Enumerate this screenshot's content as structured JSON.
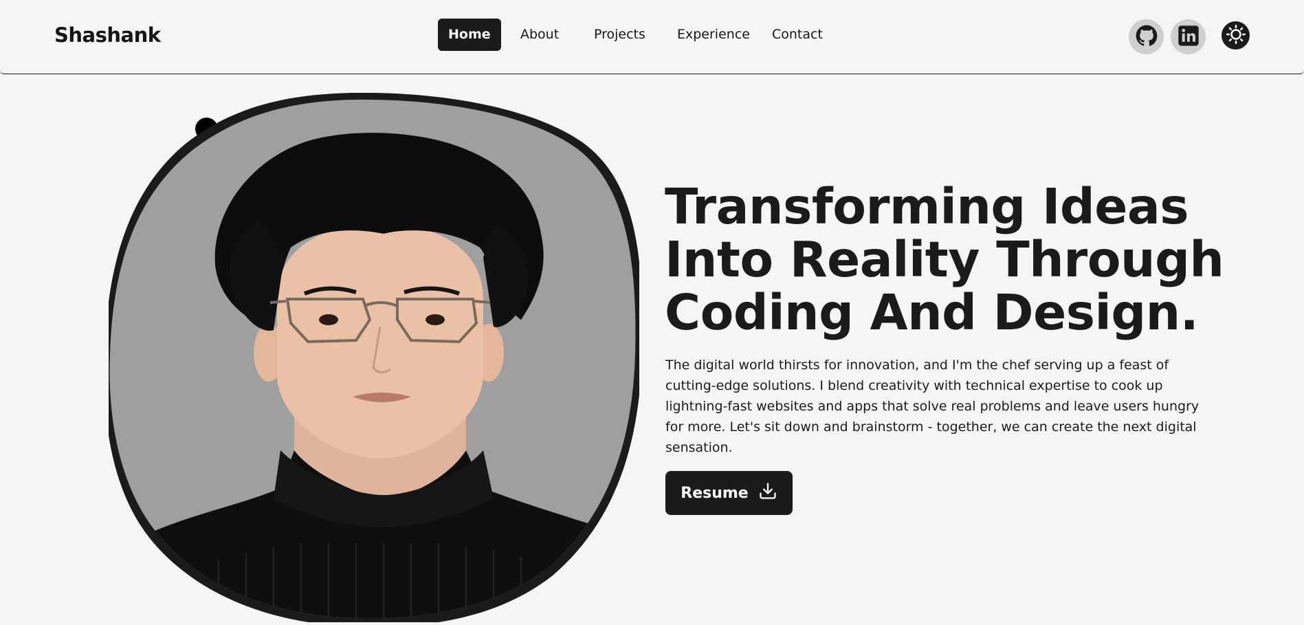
{
  "brand": {
    "name": "Shashank"
  },
  "nav": {
    "items": [
      {
        "label": "Home",
        "active": true
      },
      {
        "label": "About",
        "active": false
      },
      {
        "label": "Projects",
        "active": false
      },
      {
        "label": "Experience",
        "active": false
      },
      {
        "label": "Contact",
        "active": false
      }
    ]
  },
  "header_icons": {
    "github": "github-icon",
    "linkedin": "linkedin-icon",
    "theme": "sun-icon"
  },
  "hero": {
    "headline": "Transforming Ideas Into Reality Through Coding And Design.",
    "intro": "The digital world thirsts for innovation, and I'm the chef serving up a feast of cutting-edge solutions. I blend creativity with technical expertise to cook up lightning-fast websites and apps that solve real problems and leave users hungry for more. Let's sit down and brainstorm - together, we can create the next digital sensation.",
    "resume_label": "Resume",
    "resume_icon": "download-icon"
  },
  "colors": {
    "background": "#f5f5f5",
    "dark": "#1b1b1b",
    "portrait_bg": "#9f9f9f",
    "social_bg": "#cfcfcf"
  }
}
